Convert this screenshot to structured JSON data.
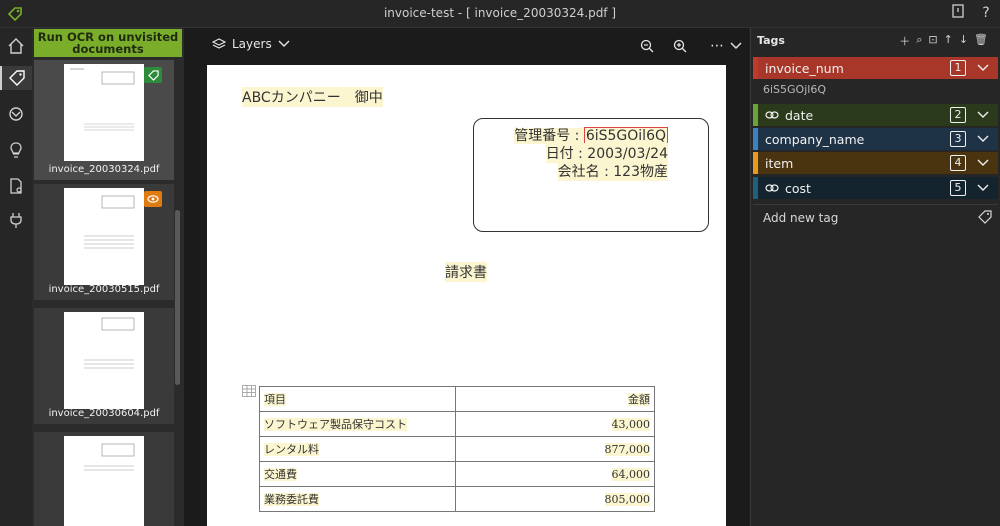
{
  "window": {
    "title": "invoice-test - [ invoice_20030324.pdf ]"
  },
  "strip": {
    "ocr_button": "Run OCR on unvisited documents",
    "thumbnails": [
      {
        "label": "invoice_20030324.pdf",
        "badge": "tag-icon",
        "badge_color": "#2e8b3a"
      },
      {
        "label": "invoice_20030515.pdf",
        "badge": "visited-icon",
        "badge_color": "#e07b10"
      },
      {
        "label": "invoice_20030604.pdf"
      },
      {
        "label": ""
      }
    ]
  },
  "toolbar": {
    "layers_label": "Layers"
  },
  "document": {
    "company": "ABCカンパニー　御中",
    "mgmt_label": "管理番号 : ",
    "mgmt_value": "6iS5GOil6Q",
    "date_line": "日付 : 2003/03/24",
    "company_line": "会社名 : 123物産",
    "heading": "請求書",
    "table": {
      "header": [
        "項目",
        "金額"
      ],
      "rows": [
        [
          "ソフトウェア製品保守コスト",
          "43,000"
        ],
        [
          "レンタル料",
          "877,000"
        ],
        [
          "交通費",
          "64,000"
        ],
        [
          "業務委託費",
          "805,000"
        ]
      ]
    }
  },
  "tags_panel": {
    "title": "Tags",
    "tags": [
      {
        "name": "invoice_num",
        "key": "1",
        "color": "#a8372a",
        "stripe": "#c0392b",
        "linked": false
      },
      {
        "name": "date",
        "key": "2",
        "color": "#2a3a1a",
        "stripe": "#6aa336",
        "linked": true
      },
      {
        "name": "company_name",
        "key": "3",
        "color": "#1e3346",
        "stripe": "#3b82c4",
        "linked": false
      },
      {
        "name": "item",
        "key": "4",
        "color": "#4a3410",
        "stripe": "#e89a1c",
        "linked": false
      },
      {
        "name": "cost",
        "key": "5",
        "color": "#14242e",
        "stripe": "#1f5f82",
        "linked": true
      }
    ],
    "invoice_num_value": "6iS5GOjl6Q",
    "add_new_tag": "Add new tag"
  }
}
